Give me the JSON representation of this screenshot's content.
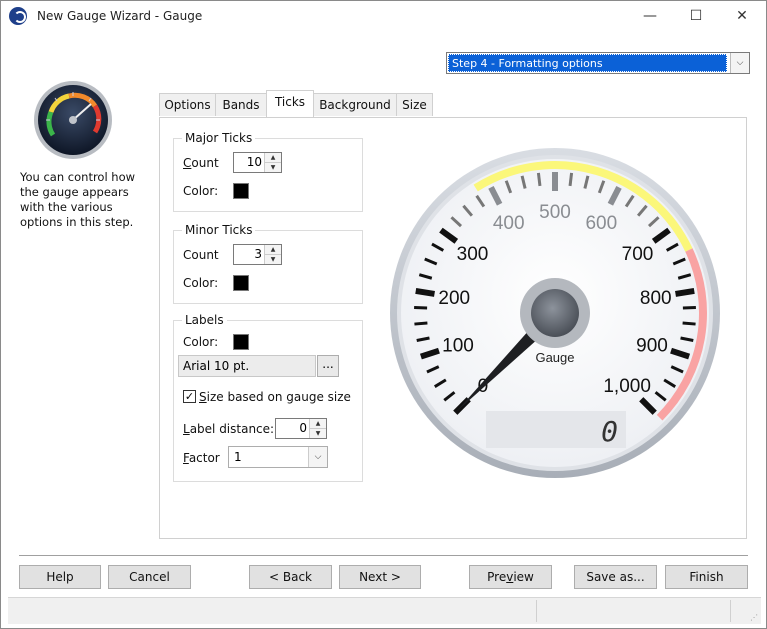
{
  "window": {
    "title": "New Gauge Wizard - Gauge",
    "controls": {
      "minimize": "—",
      "maximize": "☐",
      "close": "✕"
    }
  },
  "step_selector": {
    "selected": "Step 4 - Formatting options",
    "arrow": "⌵"
  },
  "sidebar": {
    "description": "You can control how the gauge appears with the various options in this step."
  },
  "tabs": [
    {
      "label": "Options"
    },
    {
      "label": "Bands"
    },
    {
      "label": "Ticks",
      "active": true
    },
    {
      "label": "Background"
    },
    {
      "label": "Size"
    }
  ],
  "major_ticks": {
    "title": "Major Ticks",
    "count_label_first": "C",
    "count_label_rest": "ount",
    "count_value": "10",
    "color_label": "Color:",
    "color": "#000000"
  },
  "minor_ticks": {
    "title": "Minor Ticks",
    "count_label": "Count",
    "count_value": "3",
    "color_label": "Color:",
    "color": "#000000"
  },
  "labels": {
    "title": "Labels",
    "color_label": "Color:",
    "color": "#000000",
    "font_value": "Arial 10 pt.",
    "font_button": "...",
    "size_checkbox_first": "S",
    "size_checkbox_rest": "ize based on gauge size",
    "size_checked": true,
    "distance_label_first": "L",
    "distance_label_rest": "abel distance:",
    "distance_value": "0",
    "factor_label_first": "F",
    "factor_label_rest": "actor",
    "factor_value": "1"
  },
  "gauge_preview": {
    "scale_labels": [
      "0",
      "100",
      "200",
      "300",
      "400",
      "500",
      "600",
      "700",
      "800",
      "900",
      "1,000"
    ],
    "caption": "Gauge",
    "readout": "0",
    "value": 0,
    "min": 0,
    "max": 1000,
    "yellow_band": "#fbf77a",
    "red_band": "#f9a3a3"
  },
  "buttons": {
    "help": "Help",
    "cancel": "Cancel",
    "back": "< Back",
    "next": "Next >",
    "preview_first": "Pre",
    "preview_u": "v",
    "preview_rest": "iew",
    "save_as": "Save as...",
    "finish": "Finish"
  }
}
